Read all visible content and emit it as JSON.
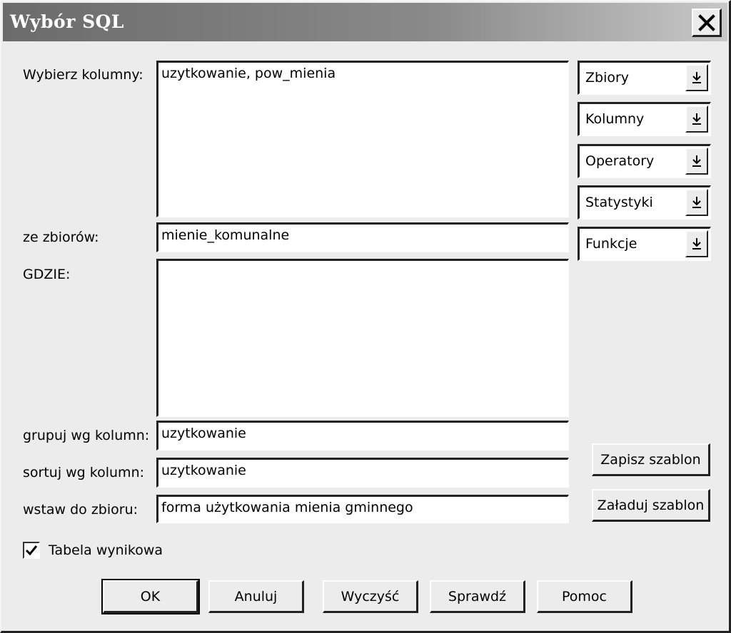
{
  "window": {
    "title": "Wybór SQL"
  },
  "labels": {
    "columns": "Wybierz kolumny:",
    "from": "ze zbiorów:",
    "where": "GDZIE:",
    "group_by": "grupuj wg kolumn:",
    "order_by": "sortuj wg kolumn:",
    "insert_into": "wstaw do zbioru:"
  },
  "fields": {
    "columns": "uzytkowanie, pow_mienia",
    "from": "mienie_komunalne",
    "where": "",
    "group_by": "uzytkowanie",
    "order_by": "uzytkowanie",
    "insert_into": "forma użytkowania mienia gminnego"
  },
  "combos": [
    {
      "label": "Zbiory"
    },
    {
      "label": "Kolumny"
    },
    {
      "label": "Operatory"
    },
    {
      "label": "Statystyki"
    },
    {
      "label": "Funkcje"
    }
  ],
  "template_buttons": {
    "save": "Zapisz szablon",
    "load": "Załaduj szablon"
  },
  "checkbox": {
    "label": "Tabela wynikowa",
    "checked": true
  },
  "buttons": {
    "ok": "OK",
    "cancel": "Anuluj",
    "clear": "Wyczyść",
    "check": "Sprawdź",
    "help": "Pomoc"
  }
}
